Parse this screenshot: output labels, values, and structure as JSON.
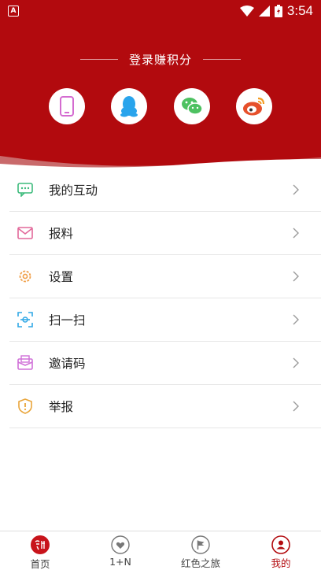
{
  "status_bar": {
    "time": "3:54",
    "app_icon_letter": "A"
  },
  "login": {
    "title": "登录赚积分"
  },
  "social": [
    {
      "name": "phone",
      "icon": "phone-icon",
      "color": "#d46bd0"
    },
    {
      "name": "qq",
      "icon": "qq-icon",
      "color": "#29a4ec"
    },
    {
      "name": "wechat",
      "icon": "wechat-icon",
      "color": "#4dc161"
    },
    {
      "name": "weibo",
      "icon": "weibo-icon",
      "color": "#e6502b"
    }
  ],
  "menu": [
    {
      "label": "我的互动",
      "icon": "chat-bubble-icon",
      "color": "#3dbb7c"
    },
    {
      "label": "报料",
      "icon": "envelope-icon",
      "color": "#e2689a"
    },
    {
      "label": "设置",
      "icon": "gear-icon",
      "color": "#f0a04a"
    },
    {
      "label": "扫一扫",
      "icon": "scan-icon",
      "color": "#31a8e6"
    },
    {
      "label": "邀请码",
      "icon": "invite-icon",
      "color": "#d070d8"
    },
    {
      "label": "举报",
      "icon": "shield-alert-icon",
      "color": "#e9a53a"
    }
  ],
  "tabs": [
    {
      "label": "首页",
      "icon": "logo-icon",
      "active": false
    },
    {
      "label": "1+N",
      "icon": "heart-icon",
      "active": false
    },
    {
      "label": "红色之旅",
      "icon": "flag-icon",
      "active": false
    },
    {
      "label": "我的",
      "icon": "person-icon",
      "active": true
    }
  ],
  "colors": {
    "brand_red": "#b20a0e",
    "divider": "#e6e6e6"
  }
}
